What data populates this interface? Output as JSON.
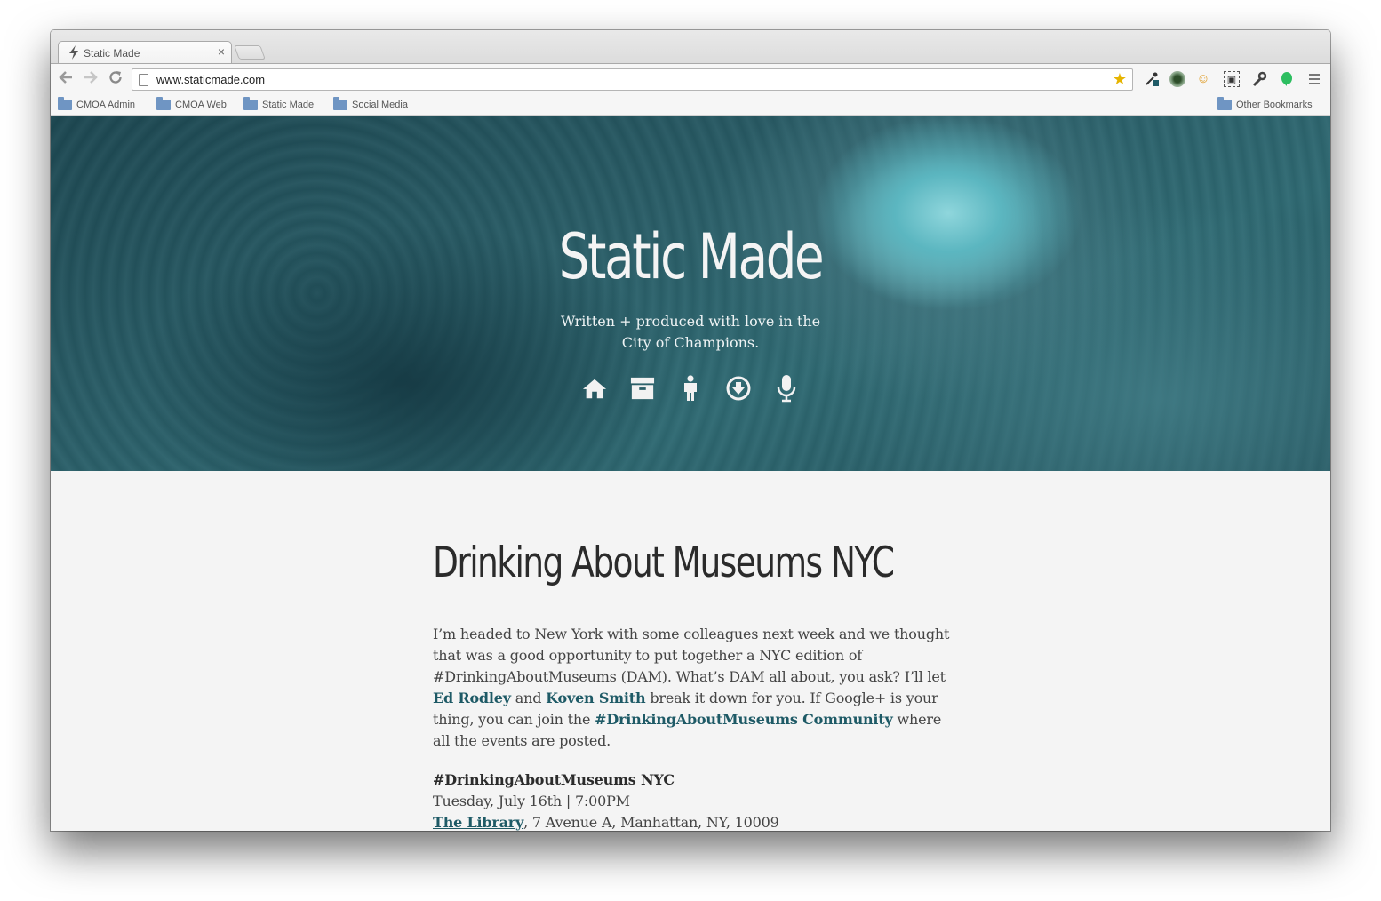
{
  "browser": {
    "tab_title": "Static Made",
    "url": "www.staticmade.com",
    "bookmarks": [
      "CMOA Admin",
      "CMOA Web",
      "Static Made",
      "Social Media"
    ],
    "other_bookmarks": "Other Bookmarks"
  },
  "hero": {
    "title": "Static Made",
    "subtitle_line1": "Written + produced with love in the",
    "subtitle_line2": "City of Champions.",
    "nav_icons": [
      "home-icon",
      "archive-icon",
      "person-icon",
      "download-icon",
      "microphone-icon"
    ]
  },
  "post": {
    "title": "Drinking About Museums NYC",
    "p1_a": "I’m headed to New York with some colleagues next week and we thought that was a good opportunity to put together a NYC edition of #DrinkingAboutMuseums (DAM). What’s DAM all about, you ask? I’ll let ",
    "link_ed": "Ed Rodley",
    "p1_and": " and ",
    "link_koven": "Koven Smith",
    "p1_b": " break it down for you. If Google+ is your thing, you can join the ",
    "link_community": "#DrinkingAboutMuseums Community",
    "p1_c": " where all the events are posted.",
    "event_title": "#DrinkingAboutMuseums NYC",
    "event_date": "Tuesday, July 16th | 7:00PM",
    "event_venue": "The Library",
    "event_address": ", 7 Avenue A, Manhattan, NY, 10009"
  },
  "colors": {
    "link": "#1e5a66",
    "hero_teal": "#2a5e68",
    "page_bg": "#f4f4f4"
  }
}
